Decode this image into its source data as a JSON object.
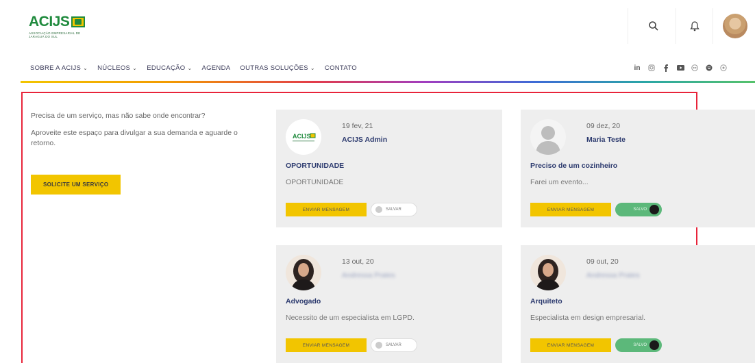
{
  "brand": {
    "logo_text": "ACIJS",
    "logo_sub": "ASSOCIAÇÃO EMPRESARIAL DE JARAGUÁ DO SUL"
  },
  "nav": {
    "items": [
      {
        "label": "SOBRE A ACIJS",
        "has_dropdown": true
      },
      {
        "label": "NÚCLEOS",
        "has_dropdown": true
      },
      {
        "label": "EDUCAÇÃO",
        "has_dropdown": true
      },
      {
        "label": "AGENDA",
        "has_dropdown": false
      },
      {
        "label": "OUTRAS SOLUÇÕES",
        "has_dropdown": true
      },
      {
        "label": "CONTATO",
        "has_dropdown": false
      }
    ],
    "chevron": "⌄"
  },
  "header_icons": [
    "search-icon",
    "bell-icon",
    "user-avatar"
  ],
  "social": {
    "linkedin": "in",
    "icons": [
      "linkedin-icon",
      "instagram-icon",
      "facebook-icon",
      "youtube-icon",
      "flickr-icon",
      "spotify-icon",
      "whatsapp-icon"
    ]
  },
  "intro": {
    "line1": "Precisa de um serviço, mas não sabe onde encontrar?",
    "line2": "Aproveite este espaço para divulgar a sua demanda e aguarde o retorno.",
    "button": "SOLICITE UM SERVIÇO"
  },
  "cards": [
    {
      "date": "19 fev, 21",
      "author": "ACIJS Admin",
      "title": "OPORTUNIDADE",
      "desc": "OPORTUNIDADE",
      "button": "ENVIAR MENSAGEM",
      "save_label": "SALVAR",
      "saved": false
    },
    {
      "date": "09 dez, 20",
      "author": "Maria Teste",
      "title": "Preciso de um cozinheiro",
      "desc": "Farei um evento...",
      "button": "ENVIAR MENSAGEM",
      "save_label": "SALVO",
      "saved": true
    },
    {
      "date": "13 out, 20",
      "author": "Andressa Prates",
      "title": "Advogado",
      "desc": "Necessito de um especialista em LGPD.",
      "button": "ENVIAR MENSAGEM",
      "save_label": "SALVAR",
      "saved": false
    },
    {
      "date": "09 out, 20",
      "author": "Andressa Prates",
      "title": "Arquiteto",
      "desc": "Especialista em design empresarial.",
      "button": "ENVIAR MENSAGEM",
      "save_label": "SALVO",
      "saved": true
    }
  ],
  "colors": {
    "accent_yellow": "#f2c500",
    "brand_green": "#1f8a3d",
    "title_navy": "#2c3a6e",
    "highlight_red": "#e8243a",
    "toggle_green": "#5cb87a"
  }
}
